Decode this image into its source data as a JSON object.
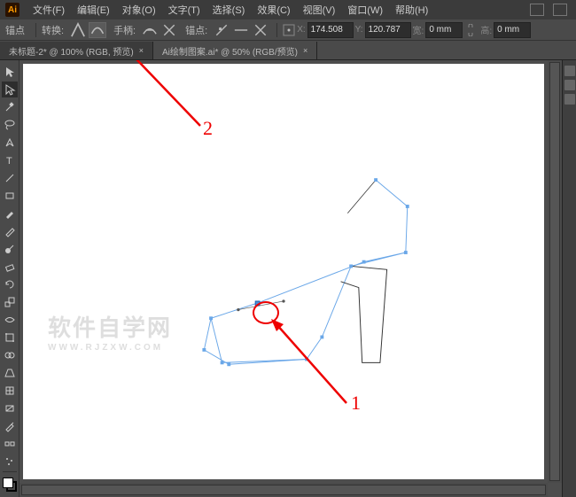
{
  "app": {
    "icon_label": "Ai"
  },
  "menu": {
    "items": [
      "文件(F)",
      "编辑(E)",
      "对象(O)",
      "文字(T)",
      "选择(S)",
      "效果(C)",
      "视图(V)",
      "窗口(W)",
      "帮助(H)"
    ]
  },
  "control": {
    "anchor_label": "锚点",
    "convert_label": "转换:",
    "handle_label": "手柄:",
    "anchor2_label": "锚点:",
    "x_value": "174.508",
    "y_value": "120.787",
    "w_value": "0 mm",
    "h_value": "0 mm"
  },
  "tabs": [
    {
      "label": "未标题-2* @ 100% (RGB, 预览)",
      "active": true
    },
    {
      "label": "Ai绘制图案.ai* @ 50% (RGB/预览)",
      "active": false
    }
  ],
  "annotations": {
    "num1": "1",
    "num2": "2"
  },
  "watermark": {
    "line1": "软件自学网",
    "line2": "WWW.RJZXW.COM"
  }
}
